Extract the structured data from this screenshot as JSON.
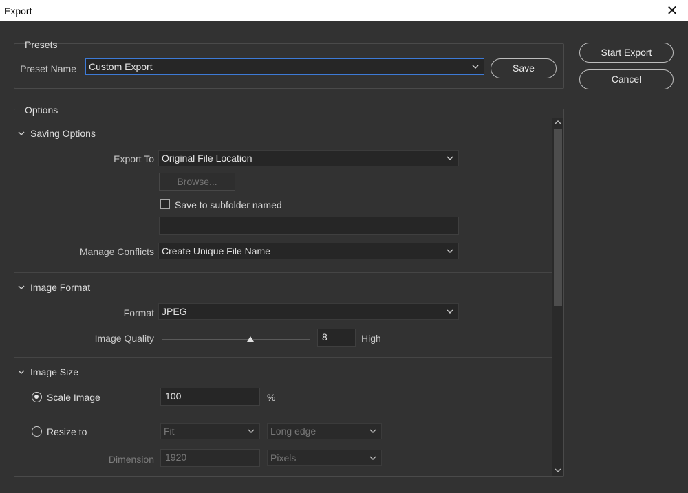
{
  "window": {
    "title": "Export",
    "close_glyph": "✕"
  },
  "presets": {
    "title": "Presets",
    "preset_name_label": "Preset Name",
    "preset_value": "Custom Export",
    "save_label": "Save"
  },
  "actions": {
    "start_export": "Start Export",
    "cancel": "Cancel"
  },
  "options": {
    "title": "Options",
    "saving": {
      "title": "Saving Options",
      "export_to_label": "Export To",
      "export_to_value": "Original File Location",
      "browse_label": "Browse...",
      "subfolder_label": "Save to subfolder named",
      "subfolder_checked": false,
      "subfolder_value": "",
      "conflicts_label": "Manage Conflicts",
      "conflicts_value": "Create Unique File Name"
    },
    "format": {
      "title": "Image Format",
      "format_label": "Format",
      "format_value": "JPEG",
      "quality_label": "Image Quality",
      "quality_value": "8",
      "quality_level": 0.6,
      "quality_text": "High"
    },
    "size": {
      "title": "Image Size",
      "scale_label": "Scale Image",
      "scale_value": "100",
      "scale_unit": "%",
      "resize_label": "Resize to",
      "fit_value": "Fit",
      "edge_value": "Long edge",
      "dimension_label": "Dimension",
      "dimension_value": "1920",
      "units_value": "Pixels",
      "selected": "scale"
    }
  }
}
